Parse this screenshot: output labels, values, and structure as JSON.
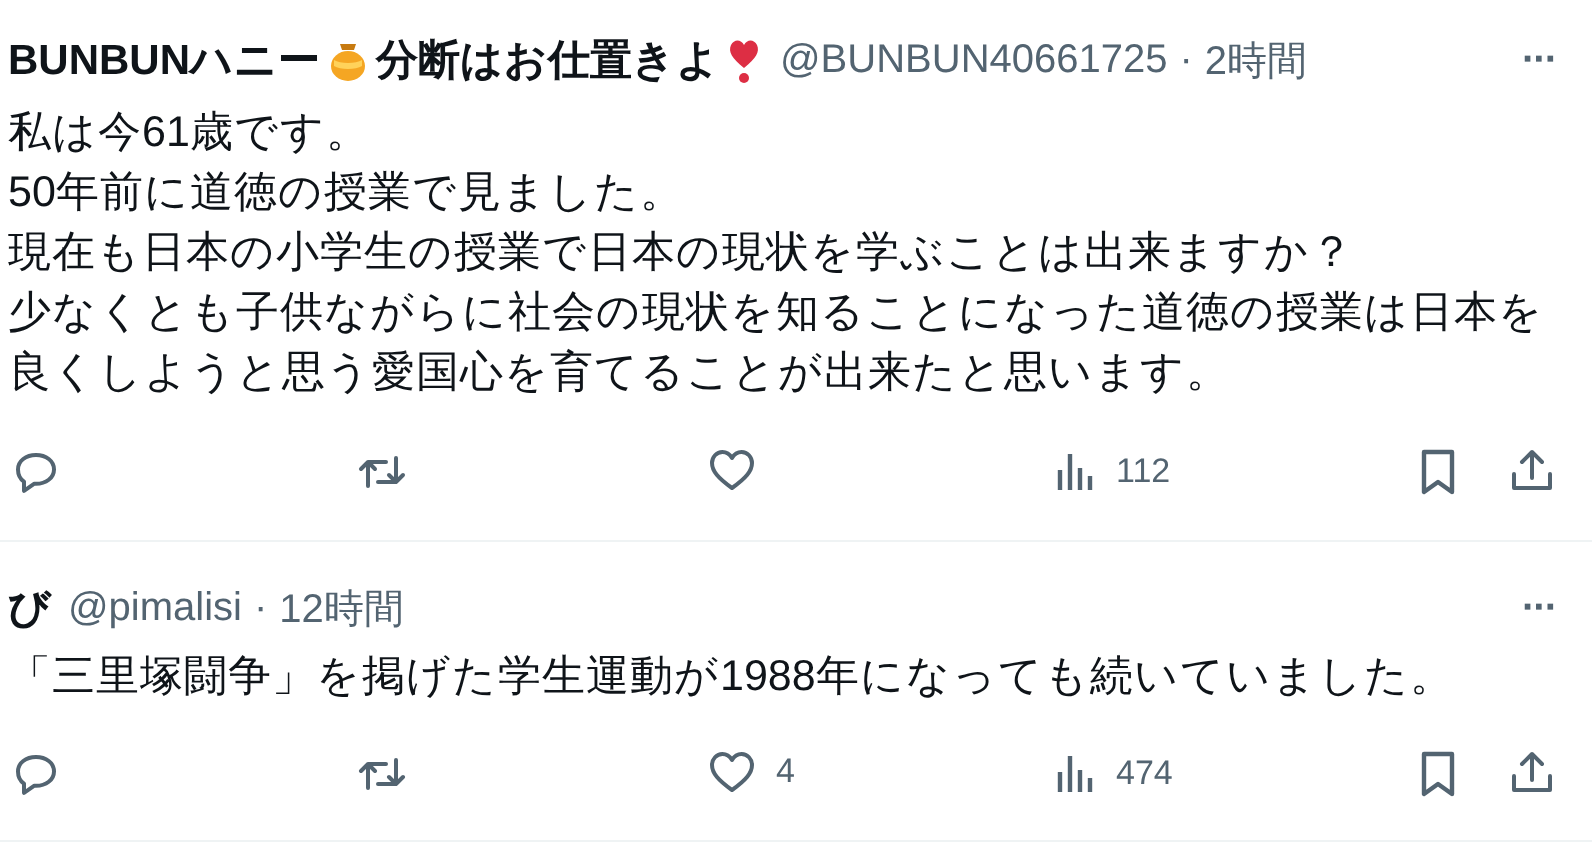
{
  "posts": [
    {
      "name_parts": [
        {
          "kind": "text",
          "text": "BUNBUNハニー"
        },
        {
          "kind": "honey_pot"
        },
        {
          "kind": "text",
          "text": "分断はお仕置きよ"
        },
        {
          "kind": "heart_exclamation"
        }
      ],
      "handle": "@BUNBUN40661725",
      "separator": "·",
      "time": "2時間",
      "more": "···",
      "body": [
        "私は今61歳です。",
        "50年前に道徳の授業で見ました。",
        "現在も日本の小学生の授業で日本の現状を学ぶことは出来ますか？",
        "少なくとも子供ながらに社会の現状を知ることになった道徳の授業は日本を",
        "良くしようと思う愛国心を育てることが出来たと思います。"
      ],
      "views": "112"
    },
    {
      "name_parts": [
        {
          "kind": "text",
          "text": "び"
        }
      ],
      "handle": "@pimalisi",
      "separator": "·",
      "time": "12時間",
      "more": "···",
      "body": [
        "「三里塚闘争」を掲げた学生運動が1988年になっても続いていました。"
      ],
      "likes": "4",
      "views": "474"
    }
  ]
}
